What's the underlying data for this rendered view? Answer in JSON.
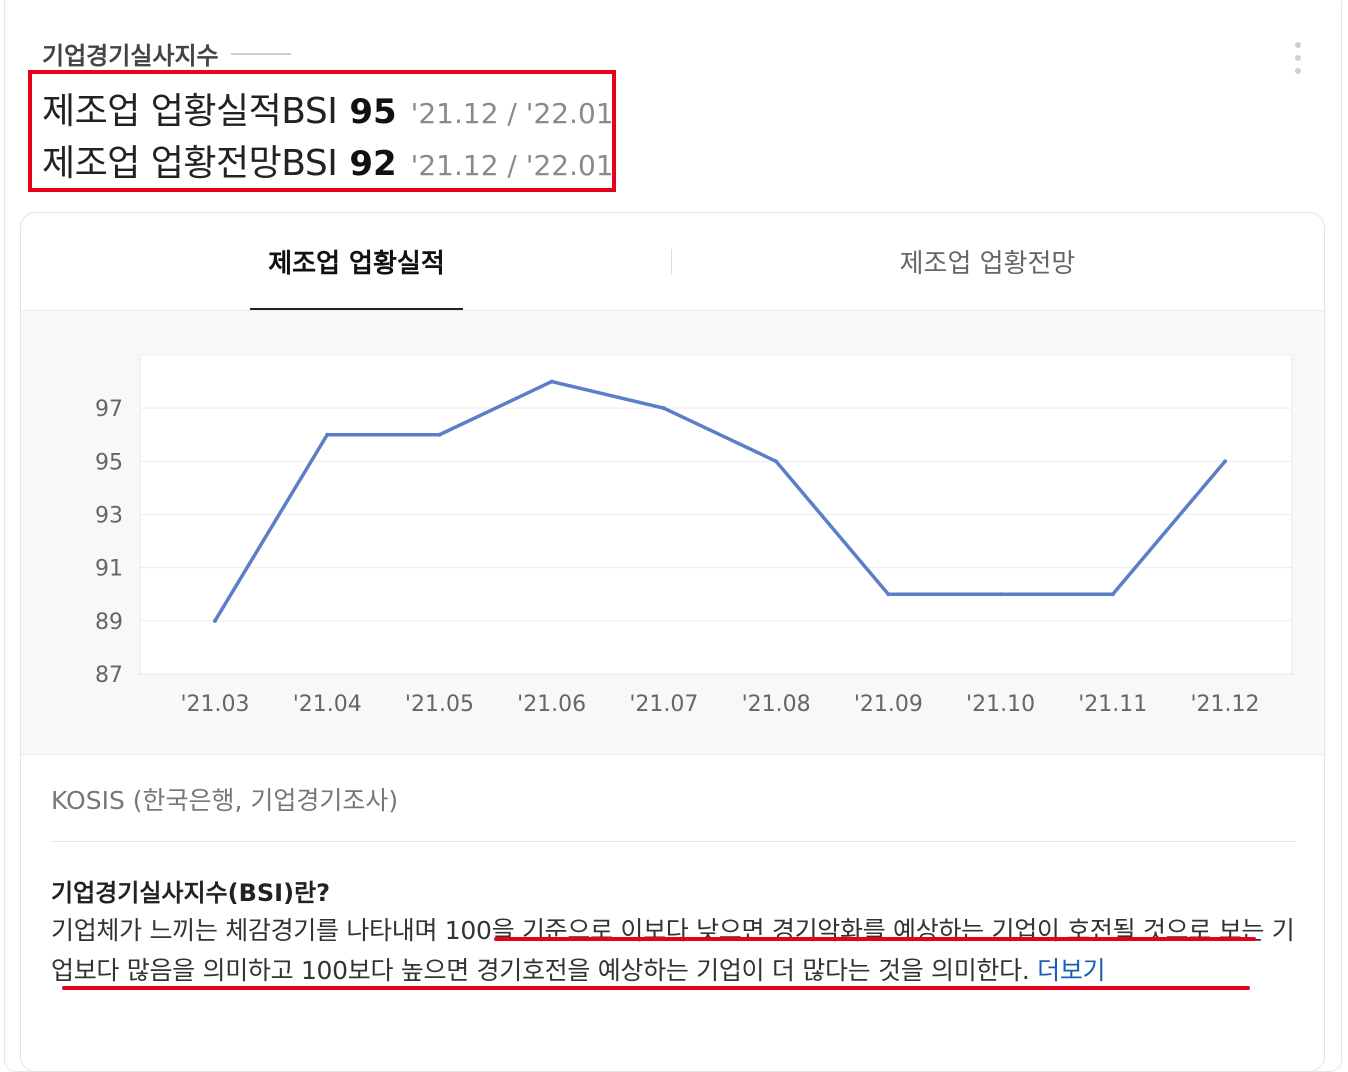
{
  "section_title": "기업경기실사지수",
  "bsi_rows": [
    {
      "name": "제조업 업황실적BSI",
      "value": "95",
      "period": "'21.12 / '22.01"
    },
    {
      "name": "제조업 업황전망BSI",
      "value": "92",
      "period": "'21.12 / '22.01"
    }
  ],
  "tabs": [
    {
      "label": "제조업 업황실적",
      "active": true
    },
    {
      "label": "제조업 업황전망",
      "active": false
    }
  ],
  "source": "KOSIS (한국은행, 기업경기조사)",
  "description": {
    "title": "기업경기실사지수(BSI)란?",
    "body": "기업체가 느끼는 체감경기를 나타내며 100을 기준으로 이보다 낮으면 경기악화를 예상하는 기업이 호전될 것으로 보는 기업보다 많음을 의미하고 100보다 높으면 경기호전을 예상하는 기업이 더 많다는 것을 의미한다.",
    "more_link": "더보기"
  },
  "colors": {
    "line": "#5b7ec9",
    "highlight": "#e8001c",
    "link": "#1a5fb4"
  },
  "chart_data": {
    "type": "line",
    "categories": [
      "'21.03",
      "'21.04",
      "'21.05",
      "'21.06",
      "'21.07",
      "'21.08",
      "'21.09",
      "'21.10",
      "'21.11",
      "'21.12"
    ],
    "values": [
      89,
      96,
      96,
      98,
      97,
      95,
      90,
      90,
      90,
      95
    ],
    "y_tick_labels": [
      "87",
      "89",
      "91",
      "93",
      "95",
      "97"
    ],
    "ylim": [
      87,
      99
    ],
    "grid": true
  }
}
